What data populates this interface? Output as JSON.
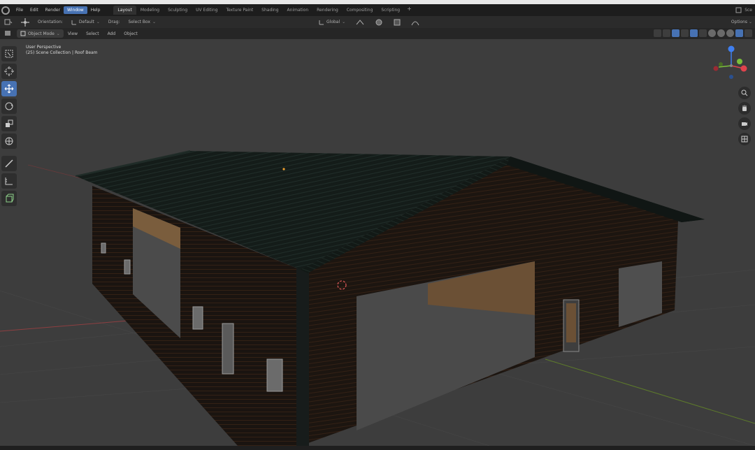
{
  "app": {
    "menu": [
      "File",
      "Edit",
      "Render",
      "Window",
      "Help"
    ],
    "menu_active_index": 3,
    "workspace_tabs": [
      "Layout",
      "Modeling",
      "Sculpting",
      "UV Editing",
      "Texture Paint",
      "Shading",
      "Animation",
      "Rendering",
      "Compositing",
      "Scripting"
    ],
    "workspace_active_index": 0,
    "scene_label": "Sce"
  },
  "tool_header": {
    "orientation_label": "Orientation:",
    "orientation_value": "Default",
    "drag_label": "Drag:",
    "drag_value": "Select Box",
    "transform_orientation": "Global",
    "options_label": "Options"
  },
  "view_header": {
    "mode": "Object Mode",
    "menus": [
      "View",
      "Select",
      "Add",
      "Object"
    ]
  },
  "viewport": {
    "view_name": "User Perspective",
    "collection_path": "(25) Scene Collection | Roof Beam"
  },
  "gizmo": {
    "axes": [
      {
        "name": "X",
        "color": "#e0434d"
      },
      {
        "name": "Y",
        "color": "#7bbf3a"
      },
      {
        "name": "Z",
        "color": "#3f7ff0"
      }
    ]
  },
  "icons": {
    "toolbar": [
      "select-box-icon",
      "cursor-icon",
      "move-icon",
      "rotate-icon",
      "scale-icon",
      "transform-icon",
      "annotate-icon",
      "measure-icon",
      "add-cube-icon"
    ],
    "nav": [
      "zoom-icon",
      "pan-hand-icon",
      "camera-icon",
      "grid-icon"
    ]
  },
  "colors": {
    "accent": "#4772b3",
    "background": "#3d3d3d"
  }
}
